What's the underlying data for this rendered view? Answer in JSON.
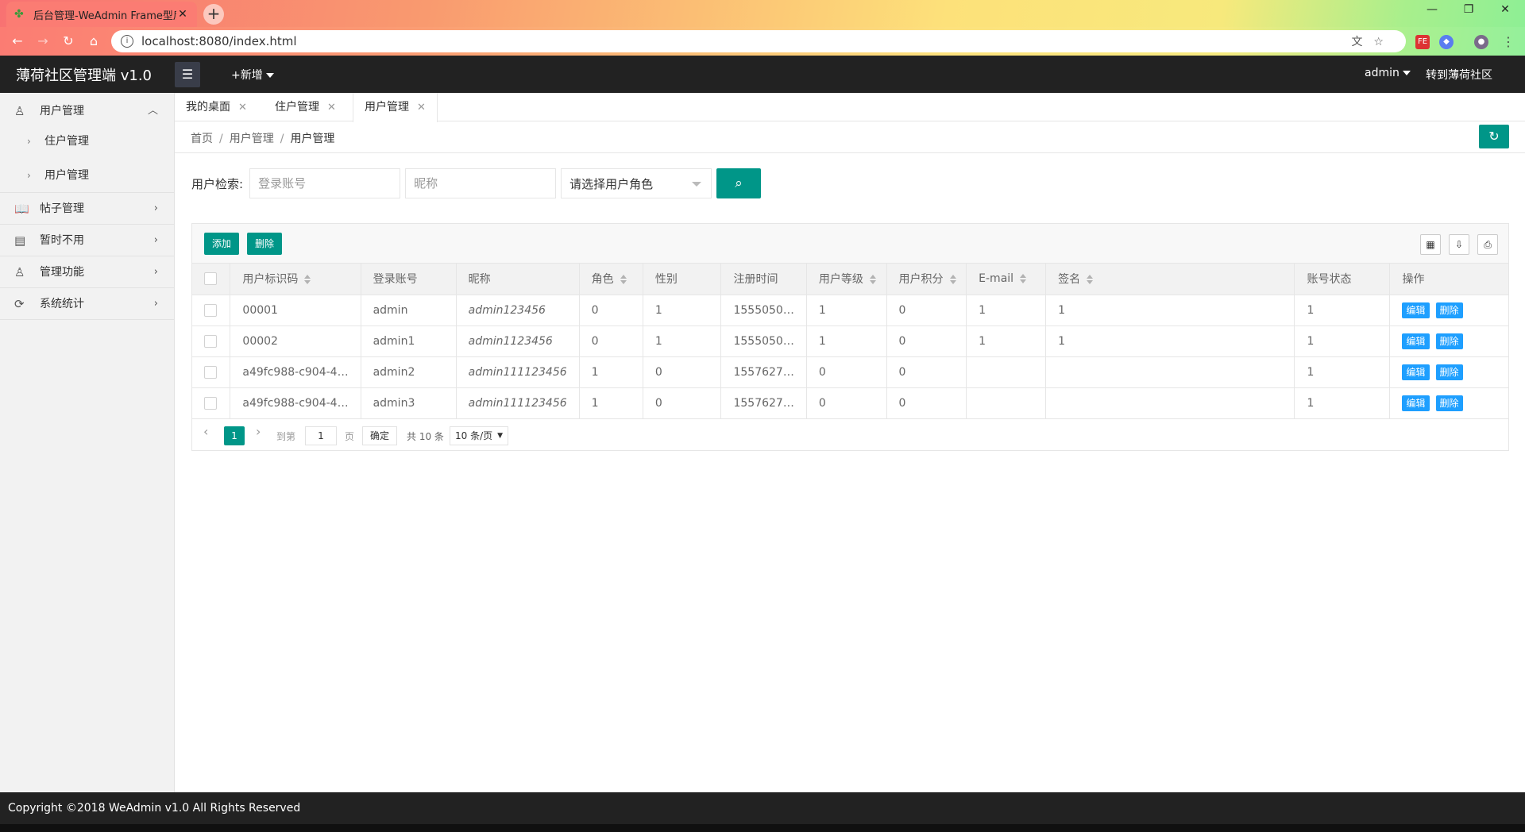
{
  "browser": {
    "tab_title": "后台管理-WeAdmin Frame型后",
    "url": "localhost:8080/index.html",
    "favicon": "clover-icon",
    "new_tab_label": "+"
  },
  "header": {
    "logo": "薄荷社区管理端 v1.0",
    "add_new": "+新增",
    "user": "admin",
    "goto_community": "转到薄荷社区"
  },
  "sidebar": {
    "groups": [
      {
        "label": "用户管理",
        "icon": "user-icon",
        "expanded": true,
        "children": [
          "住户管理",
          "用户管理"
        ]
      },
      {
        "label": "帖子管理",
        "icon": "book-icon"
      },
      {
        "label": "暂时不用",
        "icon": "document-icon"
      },
      {
        "label": "管理功能",
        "icon": "user-icon"
      },
      {
        "label": "系统统计",
        "icon": "chart-icon"
      }
    ]
  },
  "tabs": [
    {
      "label": "我的桌面"
    },
    {
      "label": "住户管理"
    },
    {
      "label": "用户管理",
      "active": true
    }
  ],
  "breadcrumb": [
    "首页",
    "用户管理",
    "用户管理"
  ],
  "search": {
    "label": "用户检索:",
    "account_placeholder": "登录账号",
    "nickname_placeholder": "昵称",
    "role_select": "请选择用户角色"
  },
  "toolbar": {
    "add_label": "添加",
    "delete_label": "删除"
  },
  "table": {
    "columns": [
      "用户标识码",
      "登录账号",
      "昵称",
      "角色",
      "性别",
      "注册时间",
      "用户等级",
      "用户积分",
      "E-mail",
      "签名",
      "账号状态",
      "操作"
    ],
    "rows": [
      [
        "00001",
        "admin",
        "admin123456",
        "0",
        "1",
        "1555050…",
        "1",
        "0",
        "1",
        "1",
        "1"
      ],
      [
        "00002",
        "admin1",
        "admin1123456",
        "0",
        "1",
        "1555050…",
        "1",
        "0",
        "1",
        "1",
        "1"
      ],
      [
        "a49fc988-c904-4…",
        "admin2",
        "admin111123456",
        "1",
        "0",
        "1557627…",
        "0",
        "0",
        "",
        "",
        "1"
      ],
      [
        "a49fc988-c904-4…",
        "admin3",
        "admin111123456",
        "1",
        "0",
        "1557627…",
        "0",
        "0",
        "",
        "",
        "1"
      ]
    ],
    "edit_label": "编辑",
    "delete_label": "删除"
  },
  "pager": {
    "current": "1",
    "goto_label": "到第",
    "goto_value": "1",
    "page_label": "页",
    "ok_label": "确定",
    "total": "共 10 条",
    "page_size": "10 条/页"
  },
  "footer": "Copyright ©2018 WeAdmin v1.0 All Rights Reserved",
  "colors": {
    "accent": "#009688",
    "edit_blue": "#1E9FFF",
    "header": "#222222"
  }
}
